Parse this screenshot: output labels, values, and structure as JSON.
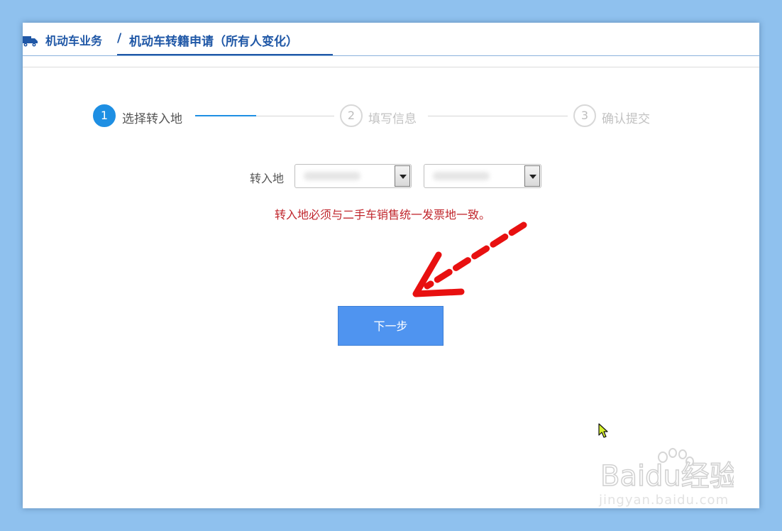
{
  "breadcrumb": {
    "parent": "机动车业务",
    "separator": "/",
    "current": "机动车转籍申请（所有人变化）"
  },
  "steps": [
    {
      "number": "1",
      "label": "选择转入地",
      "state": "active"
    },
    {
      "number": "2",
      "label": "填写信息",
      "state": "pending"
    },
    {
      "number": "3",
      "label": "确认提交",
      "state": "pending"
    }
  ],
  "form": {
    "destination_label": "转入地",
    "notice": "转入地必须与二手车销售统一发票地一致。"
  },
  "next_button": {
    "label": "下一步"
  },
  "watermark": {
    "logo_text": "Baidu经验",
    "url": "jingyan.baidu.com"
  },
  "colors": {
    "accent": "#1e8fe3",
    "breadcrumb": "#1f57a6",
    "notice": "#c0262c",
    "button": "#4f94f0",
    "annotation_arrow": "#e81010"
  },
  "icons": [
    "truck-icon",
    "select-dropdown-icon",
    "annotation-arrow",
    "mouse-cursor-icon"
  ]
}
